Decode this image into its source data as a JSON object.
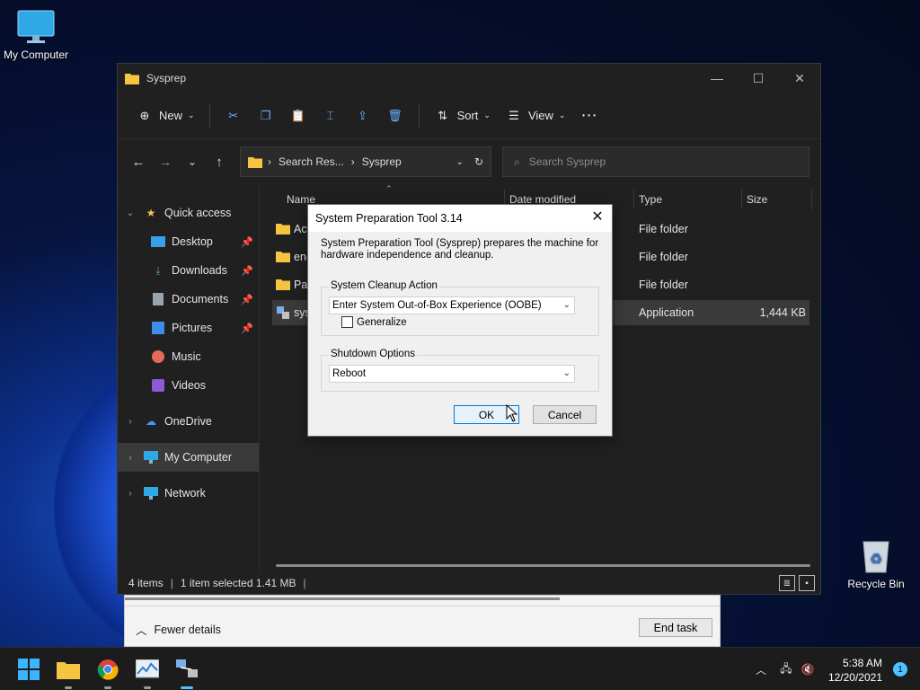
{
  "desktop": {
    "my_computer_label": "My Computer",
    "recycle_bin_label": "Recycle Bin"
  },
  "explorer": {
    "title": "Sysprep",
    "toolbar": {
      "new_label": "New",
      "sort_label": "Sort",
      "view_label": "View"
    },
    "breadcrumb": [
      "Search Res...",
      "Sysprep"
    ],
    "search_placeholder": "Search Sysprep",
    "nav": {
      "quick_access": "Quick access",
      "desktop": "Desktop",
      "downloads": "Downloads",
      "documents": "Documents",
      "pictures": "Pictures",
      "music": "Music",
      "videos": "Videos",
      "onedrive": "OneDrive",
      "my_computer": "My Computer",
      "network": "Network"
    },
    "columns": {
      "name": "Name",
      "date_modified": "Date modified",
      "type": "Type",
      "size": "Size"
    },
    "files": [
      {
        "name": "Ac",
        "type": "File folder",
        "size": ""
      },
      {
        "name": "en-",
        "type": "File folder",
        "size": ""
      },
      {
        "name": "Pa",
        "type": "File folder",
        "size": ""
      },
      {
        "name": "sys",
        "type": "Application",
        "size": "1,444 KB"
      }
    ],
    "status": {
      "items": "4 items",
      "selected": "1 item selected  1.41 MB"
    }
  },
  "taskmgr": {
    "fewer_details": "Fewer details",
    "end_task": "End task"
  },
  "dialog": {
    "title": "System Preparation Tool 3.14",
    "description": "System Preparation Tool (Sysprep) prepares the machine for hardware independence and cleanup.",
    "cleanup_group": "System Cleanup Action",
    "cleanup_value": "Enter System Out-of-Box Experience (OOBE)",
    "generalize_label": "Generalize",
    "shutdown_group": "Shutdown Options",
    "shutdown_value": "Reboot",
    "ok_label": "OK",
    "cancel_label": "Cancel"
  },
  "taskbar": {
    "time": "5:38 AM",
    "date": "12/20/2021",
    "notification_count": "1"
  },
  "colors": {
    "folder": "#f5c542",
    "accent": "#4cc2ff",
    "dialog_default_border": "#0078d7"
  }
}
